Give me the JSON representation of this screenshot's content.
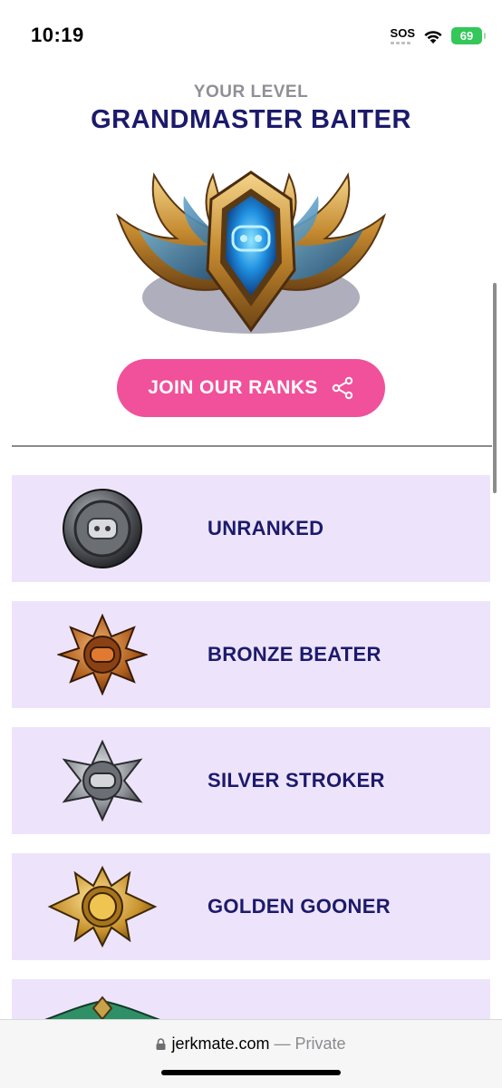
{
  "status_bar": {
    "time": "10:19",
    "sos": "SOS",
    "battery": "69",
    "icons": [
      "sos-indicator",
      "wifi-icon",
      "battery-icon"
    ]
  },
  "header": {
    "eyebrow": "YOUR LEVEL",
    "title": "GRANDMASTER BAITER",
    "badge_icon": "winged-grandmaster-badge"
  },
  "join_button": {
    "label": "JOIN OUR RANKS",
    "icon": "share-icon"
  },
  "ranks": [
    {
      "label": "UNRANKED",
      "icon": "iron-shield-badge"
    },
    {
      "label": "BRONZE BEATER",
      "icon": "bronze-star-badge"
    },
    {
      "label": "SILVER STROKER",
      "icon": "silver-star-badge"
    },
    {
      "label": "GOLDEN GOONER",
      "icon": "gold-sun-badge"
    },
    {
      "label": "",
      "icon": "emerald-winged-badge"
    }
  ],
  "browser": {
    "domain": "jerkmate.com",
    "separator": "—",
    "mode": "Private"
  },
  "colors": {
    "accent_pink": "#f0519a",
    "title_navy": "#1c1a6b",
    "card_lavender": "#ede4fb",
    "eyebrow_gray": "#8f8f96",
    "battery_green": "#34c759"
  }
}
